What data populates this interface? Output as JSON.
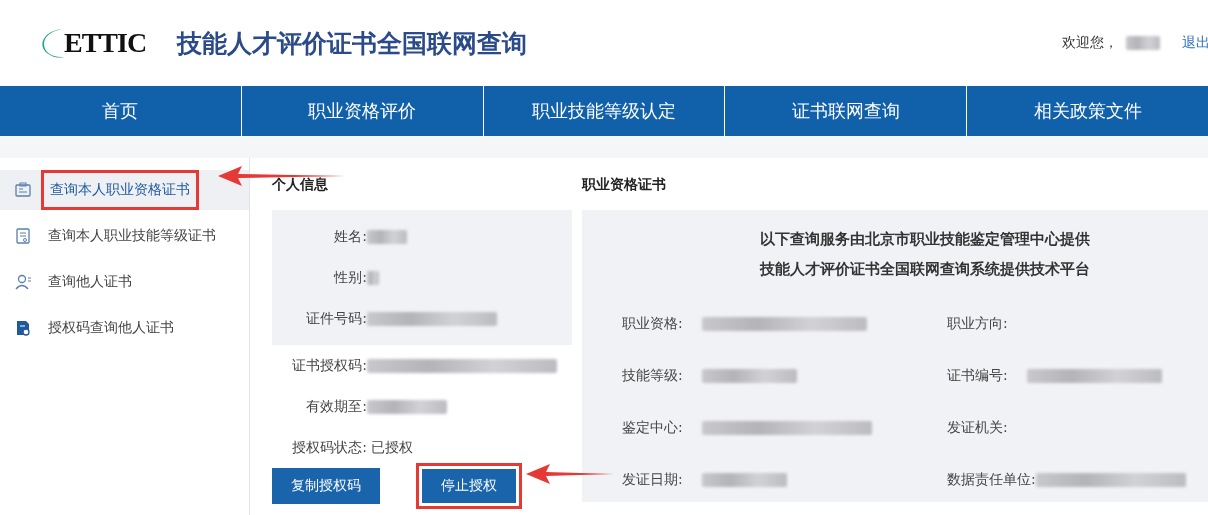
{
  "header": {
    "logo": "ETTIC",
    "title": "技能人才评价证书全国联网查询",
    "welcome": "欢迎您，",
    "logout": "退出"
  },
  "nav": [
    {
      "label": "首页",
      "selected": false
    },
    {
      "label": "职业资格评价",
      "selected": false
    },
    {
      "label": "职业技能等级认定",
      "selected": false
    },
    {
      "label": "证书联网查询",
      "selected": false
    },
    {
      "label": "相关政策文件",
      "selected": false
    }
  ],
  "sidebar": {
    "items": [
      {
        "label": "查询本人职业资格证书",
        "selected": true,
        "highlighted": true
      },
      {
        "label": "查询本人职业技能等级证书",
        "selected": false,
        "highlighted": false
      },
      {
        "label": "查询他人证书",
        "selected": false,
        "highlighted": false
      },
      {
        "label": "授权码查询他人证书",
        "selected": false,
        "highlighted": false
      }
    ]
  },
  "personal": {
    "heading": "个人信息",
    "boxed_fields": [
      {
        "label": "姓名:",
        "redacted": true
      },
      {
        "label": "性别:",
        "redacted": true
      },
      {
        "label": "证件号码:",
        "redacted": true
      }
    ],
    "fields": [
      {
        "label": "证书授权码:",
        "redacted": true
      },
      {
        "label": "有效期至:",
        "redacted": true
      },
      {
        "label": "授权码状态:",
        "value": "已授权",
        "redacted": false
      }
    ],
    "buttons": [
      {
        "label": "复制授权码",
        "highlighted": false
      },
      {
        "label": "停止授权",
        "highlighted": true
      }
    ]
  },
  "certificate": {
    "heading": "职业资格证书",
    "notice": [
      "以下查询服务由北京市职业技能鉴定管理中心提供",
      "技能人才评价证书全国联网查询系统提供技术平台"
    ],
    "fields": [
      {
        "label": "职业资格:",
        "redacted": true
      },
      {
        "label": "职业方向:",
        "redacted": false
      },
      {
        "label": "技能等级:",
        "redacted": true
      },
      {
        "label": "证书编号:",
        "redacted": true
      },
      {
        "label": "鉴定中心:",
        "redacted": true
      },
      {
        "label": "发证机关:",
        "redacted": false
      },
      {
        "label": "发证日期:",
        "redacted": true
      },
      {
        "label": "数据责任单位:",
        "redacted": true
      }
    ]
  }
}
